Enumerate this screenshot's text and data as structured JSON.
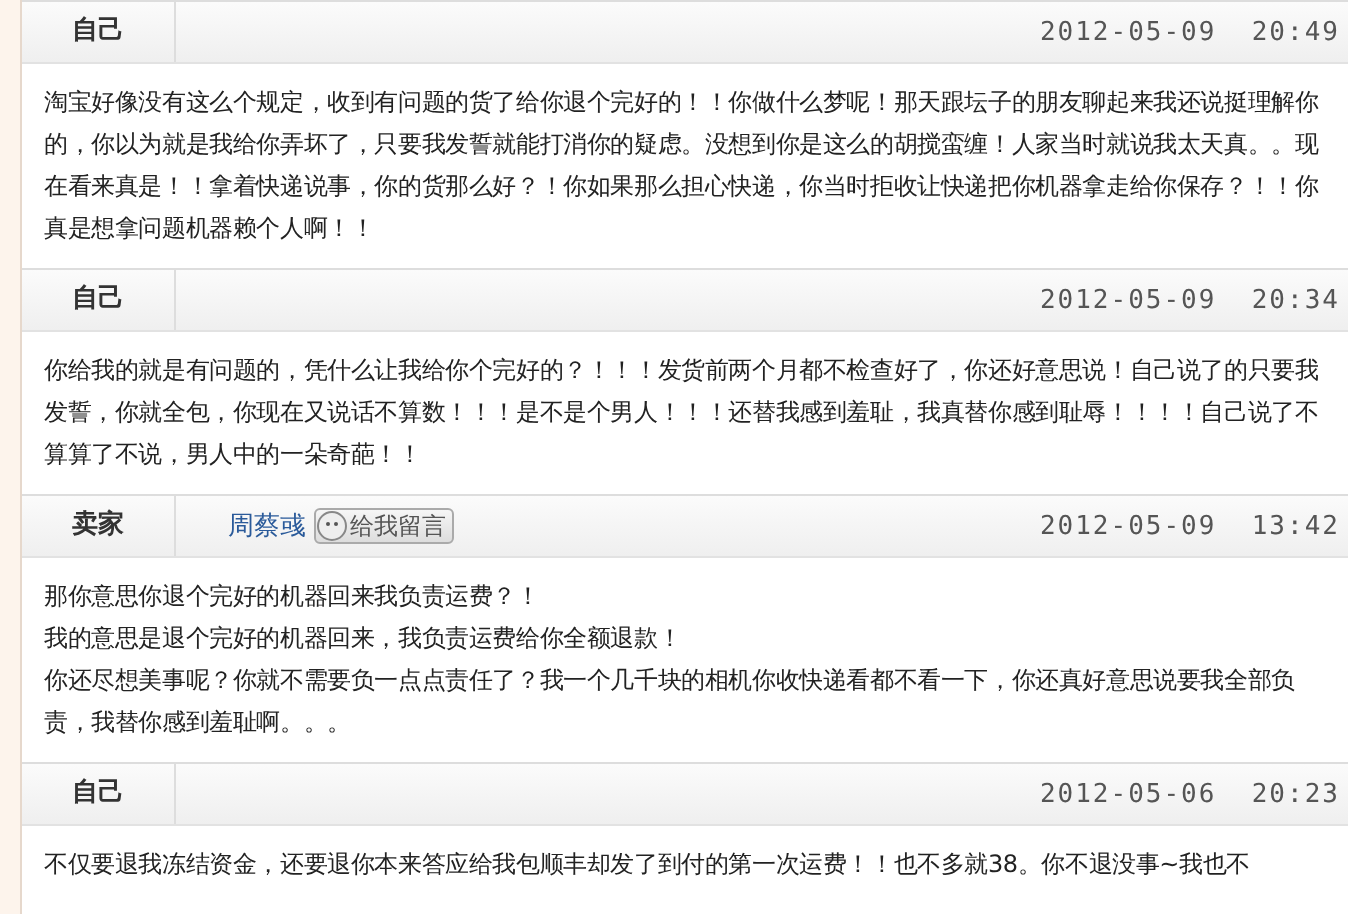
{
  "posts": [
    {
      "author": "自己",
      "time": "2012-05-09  20:49",
      "paragraphs": [
        "淘宝好像没有这么个规定，收到有问题的货了给你退个完好的！！你做什么梦呢！那天跟坛子的朋友聊起来我还说挺理解你的，你以为就是我给你弄坏了，只要我发誓就能打消你的疑虑。没想到你是这么的胡搅蛮缠！人家当时就说我太天真。。现在看来真是！！拿着快递说事，你的货那么好？！你如果那么担心快递，你当时拒收让快递把你机器拿走给你保存？！！你真是想拿问题机器赖个人啊！！"
      ]
    },
    {
      "author": "自己",
      "time": "2012-05-09  20:34",
      "paragraphs": [
        "你给我的就是有问题的，凭什么让我给你个完好的？！！！发货前两个月都不检查好了，你还好意思说！自己说了的只要我发誓，你就全包，你现在又说话不算数！！！是不是个男人！！！还替我感到羞耻，我真替你感到耻辱！！！！自己说了不算算了不说，男人中的一朵奇葩！！"
      ]
    },
    {
      "author": "卖家",
      "time": "2012-05-09  13:42",
      "contact": {
        "name": "周蔡彧",
        "button": "给我留言"
      },
      "paragraphs": [
        "那你意思你退个完好的机器回来我负责运费？！",
        "我的意思是退个完好的机器回来，我负责运费给你全额退款！",
        "你还尽想美事呢？你就不需要负一点点责任了？我一个几千块的相机你收快递看都不看一下，你还真好意思说要我全部负责，我替你感到羞耻啊。。。"
      ]
    },
    {
      "author": "自己",
      "time": "2012-05-06  20:23",
      "paragraphs": [
        "不仅要退我冻结资金，还要退你本来答应给我包顺丰却发了到付的第一次运费！！也不多就38。你不退没事~我也不"
      ]
    }
  ]
}
